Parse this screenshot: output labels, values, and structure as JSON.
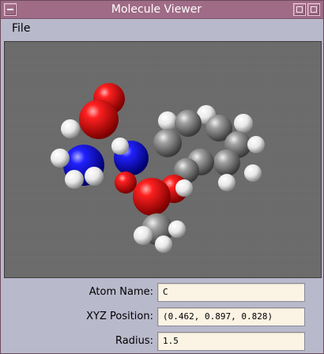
{
  "window": {
    "title": "Molecule Viewer"
  },
  "menu": {
    "file_label": "File"
  },
  "fields": {
    "atom_name_label": "Atom Name:",
    "atom_name_value": "C",
    "xyz_label": "XYZ Position:",
    "xyz_value": "(0.462, 0.897, 0.828)",
    "radius_label": "Radius:",
    "radius_value": "1.5"
  },
  "colors": {
    "titlebar": "#9f6b86",
    "window_bg": "#b9b9cc",
    "viewport_bg": "#6b6b6b",
    "oxygen": "#e00000",
    "nitrogen": "#1010e0",
    "carbon": "#8c8c8c",
    "hydrogen": "#ffffff"
  }
}
